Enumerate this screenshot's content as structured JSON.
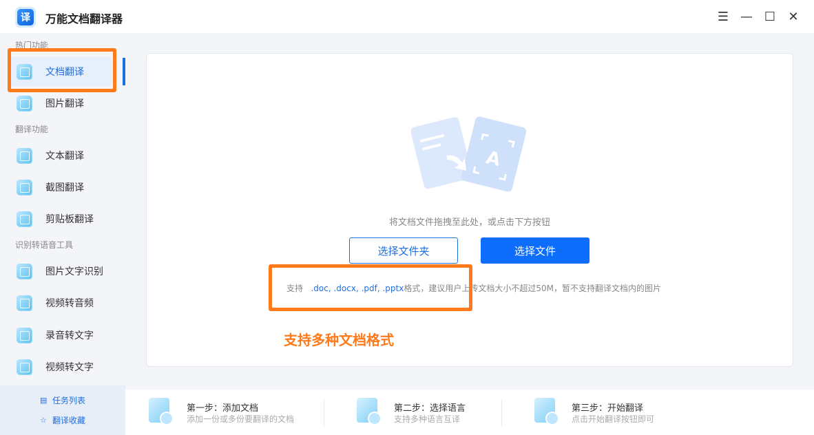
{
  "app": {
    "logo_text": "译",
    "title": "万能文档翻译器"
  },
  "window_controls": {
    "menu": "☰",
    "minimize": "—",
    "maximize": "☐",
    "close": "✕"
  },
  "sidebar": {
    "sections": [
      {
        "title": "热门功能"
      },
      {
        "title": "翻译功能"
      },
      {
        "title": "识别转语音工具"
      }
    ],
    "items": [
      {
        "label": "文档翻译",
        "icon": "document-translate-icon",
        "active": true
      },
      {
        "label": "图片翻译",
        "icon": "image-translate-icon"
      },
      {
        "label": "文本翻译",
        "icon": "text-translate-icon"
      },
      {
        "label": "截图翻译",
        "icon": "screenshot-translate-icon"
      },
      {
        "label": "剪贴板翻译",
        "icon": "clipboard-translate-icon"
      },
      {
        "label": "图片文字识别",
        "icon": "ocr-icon"
      },
      {
        "label": "视频转音频",
        "icon": "video-to-audio-icon"
      },
      {
        "label": "录音转文字",
        "icon": "audio-to-text-icon"
      },
      {
        "label": "视频转文字",
        "icon": "video-to-text-icon"
      }
    ],
    "bottom_links": [
      {
        "label": "任务列表",
        "icon": "task-list-icon",
        "glyph": "▤"
      },
      {
        "label": "翻译收藏",
        "icon": "star-icon",
        "glyph": "☆"
      }
    ]
  },
  "main": {
    "drop_hint": "将文档文件拖拽至此处，或点击下方按钮",
    "select_folder_label": "选择文件夹",
    "select_file_label": "选择文件",
    "support_prefix": "支持",
    "support_formats": ".doc, .docx, .pdf, .pptx",
    "support_suffix": "格式，建议用户上传文档大小不超过50M，暂不支持翻译文档内的图片",
    "annotation": "支持多种文档格式"
  },
  "steps": [
    {
      "title": "第一步：添加文档",
      "desc": "添加一份或多份要翻译的文档"
    },
    {
      "title": "第二步：选择语言",
      "desc": "支持多种语言互译"
    },
    {
      "title": "第三步：开始翻译",
      "desc": "点击开始翻译按钮即可"
    }
  ],
  "colors": {
    "accent": "#1f6fe0",
    "primary_button": "#0d6efd",
    "highlight": "#ff7a1a"
  }
}
